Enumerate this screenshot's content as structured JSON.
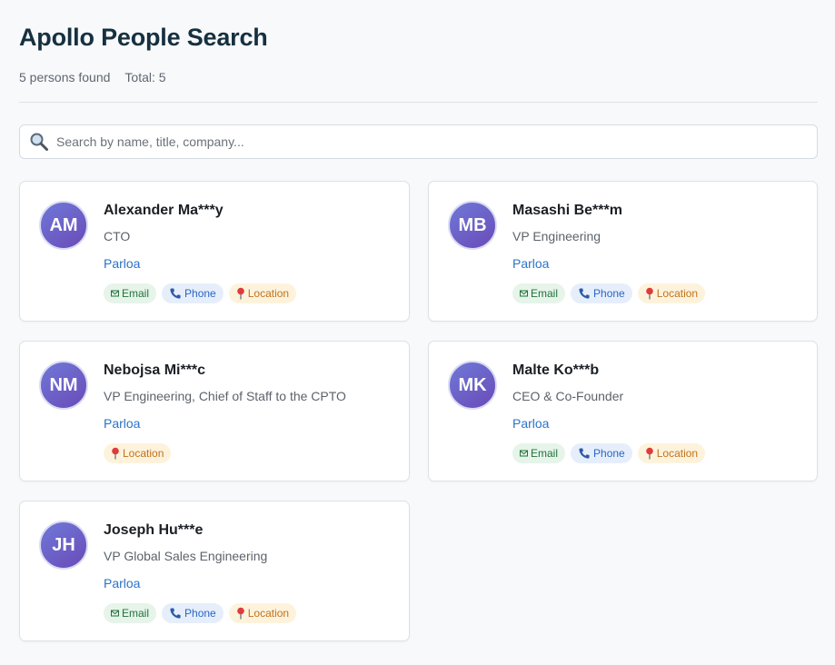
{
  "header": {
    "title": "Apollo People Search",
    "found_text": "5 persons found",
    "total_text": "Total: 5"
  },
  "search": {
    "placeholder": "Search by name, title, company...",
    "value": "",
    "icon": "magnifier-icon"
  },
  "tag_labels": {
    "email": "Email",
    "phone": "Phone",
    "location": "Location"
  },
  "colors": {
    "accent_link": "#2b73c9",
    "avatar_start": "#6f78d8",
    "avatar_end": "#6a4bb8",
    "email_bg": "#e6f4ea",
    "phone_bg": "#e6eefb",
    "location_bg": "#fdf3dc"
  },
  "people": [
    {
      "initials": "AM",
      "name": "Alexander Ma***y",
      "title": "CTO",
      "company": "Parloa",
      "email": true,
      "phone": true,
      "location": true
    },
    {
      "initials": "MB",
      "name": "Masashi Be***m",
      "title": "VP Engineering",
      "company": "Parloa",
      "email": true,
      "phone": true,
      "location": true
    },
    {
      "initials": "NM",
      "name": "Nebojsa Mi***c",
      "title": "VP Engineering, Chief of Staff to the CPTO",
      "company": "Parloa",
      "email": false,
      "phone": false,
      "location": true
    },
    {
      "initials": "MK",
      "name": "Malte Ko***b",
      "title": "CEO & Co-Founder",
      "company": "Parloa",
      "email": true,
      "phone": true,
      "location": true
    },
    {
      "initials": "JH",
      "name": "Joseph Hu***e",
      "title": "VP Global Sales Engineering",
      "company": "Parloa",
      "email": true,
      "phone": true,
      "location": true
    }
  ]
}
